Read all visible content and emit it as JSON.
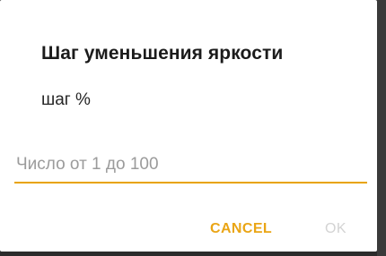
{
  "dialog": {
    "title": "Шаг уменьшения яркости",
    "message": "шаг %",
    "input": {
      "value": "",
      "placeholder": "Число от 1 до 100"
    },
    "buttons": {
      "cancel_label": "CANCEL",
      "ok_label": "OK"
    }
  },
  "colors": {
    "accent": "#e8a300",
    "disabled": "#d3d3d3"
  }
}
